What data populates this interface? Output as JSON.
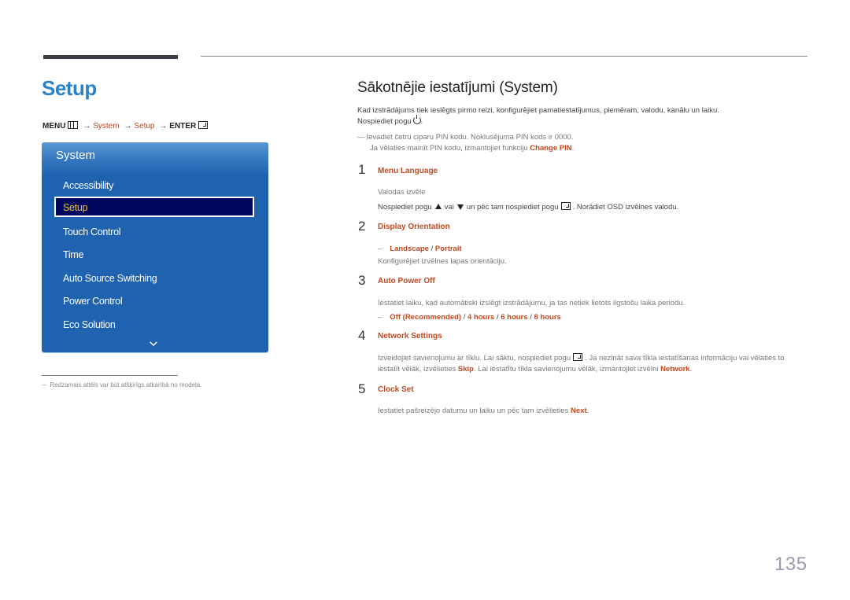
{
  "header": {
    "page_title": "Setup",
    "menu_path": {
      "menu": "MENU",
      "system": "System",
      "setup": "Setup",
      "enter": "ENTER",
      "arrow": "→"
    }
  },
  "osd": {
    "title": "System",
    "items": [
      {
        "label": "Accessibility",
        "selected": false
      },
      {
        "label": "Setup",
        "selected": true
      },
      {
        "label": "Touch Control",
        "selected": false
      },
      {
        "label": "Time",
        "selected": false
      },
      {
        "label": "Auto Source Switching",
        "selected": false
      },
      {
        "label": "Power Control",
        "selected": false
      },
      {
        "label": "Eco Solution",
        "selected": false
      }
    ],
    "scroll_icon": "chevron-down-icon",
    "colors": {
      "panel": "#1f62b0",
      "selected_bg": "#00055e",
      "selected_text": "#f6c22a"
    }
  },
  "footnote": "Redzamais attēls var būt atšķirīgs atkarībā no modeļa.",
  "main": {
    "section_title": "Sākotnējie iestatījumi (System)",
    "intro_line1": "Kad izstrādājums tiek ieslēgts pirmo reizi, konfigurējiet pamatiestatījumus, piemēram, valodu, kanālu un laiku.",
    "intro_line2": "Nospiediet pogu",
    "note_line1": "Ievadiet četru ciparu PIN kodu. Noklusējuma PIN kods ir 0000.",
    "note_line2_pre": "Ja vēlaties mainīt PIN kodu, izmantojiet funkciju",
    "note_line2_link": "Change PIN",
    "steps": [
      {
        "number": "1",
        "title": "Menu Language",
        "line1": "Valodas izvēle",
        "line2_a": "Nospiediet pogu",
        "line2_b": "vai",
        "line2_c": "un pēc tam nospiediet pogu",
        "line2_d": ". Norādiet OSD izvēlnes valodu."
      },
      {
        "number": "2",
        "title": "Display Orientation",
        "option_a": "Landscape",
        "sep": "/",
        "option_b": "Portrait",
        "desc": "Konfigurējiet izvēlnes lapas orientāciju."
      },
      {
        "number": "3",
        "title": "Auto Power Off",
        "desc": "Iestatiet laiku, kad automātiski izslēgt izstrādājumu, ja tas netiek lietots ilgstošu laika periodu.",
        "options": [
          "Off (Recommended)",
          "4 hours",
          "6 hours",
          "8 hours"
        ]
      },
      {
        "number": "4",
        "title": "Network Settings",
        "line1_a": "Izveidojiet savienojumu ar tīklu. Lai sāktu, nospiediet pogu",
        "line1_b": ". Ja nezināt sava tīkla iestatīšanas informāciju vai vēlaties to",
        "line2_a": "iestatīt vēlāk, izvēlieties",
        "line2_skip": "Skip",
        "line2_b": ". Lai iestatītu tīkla savienojumu vēlāk, izmantojiet izvēlni",
        "line2_network": "Network",
        "line2_c": "."
      },
      {
        "number": "5",
        "title": "Clock Set",
        "desc_a": "Iestatiet pašreizējo datumu un laiku un pēc tam izvēlieties",
        "desc_next": "Next",
        "desc_b": "."
      }
    ]
  },
  "page_number": "135",
  "colors": {
    "title_blue": "#2a82c9",
    "link_orange": "#c2491f"
  }
}
